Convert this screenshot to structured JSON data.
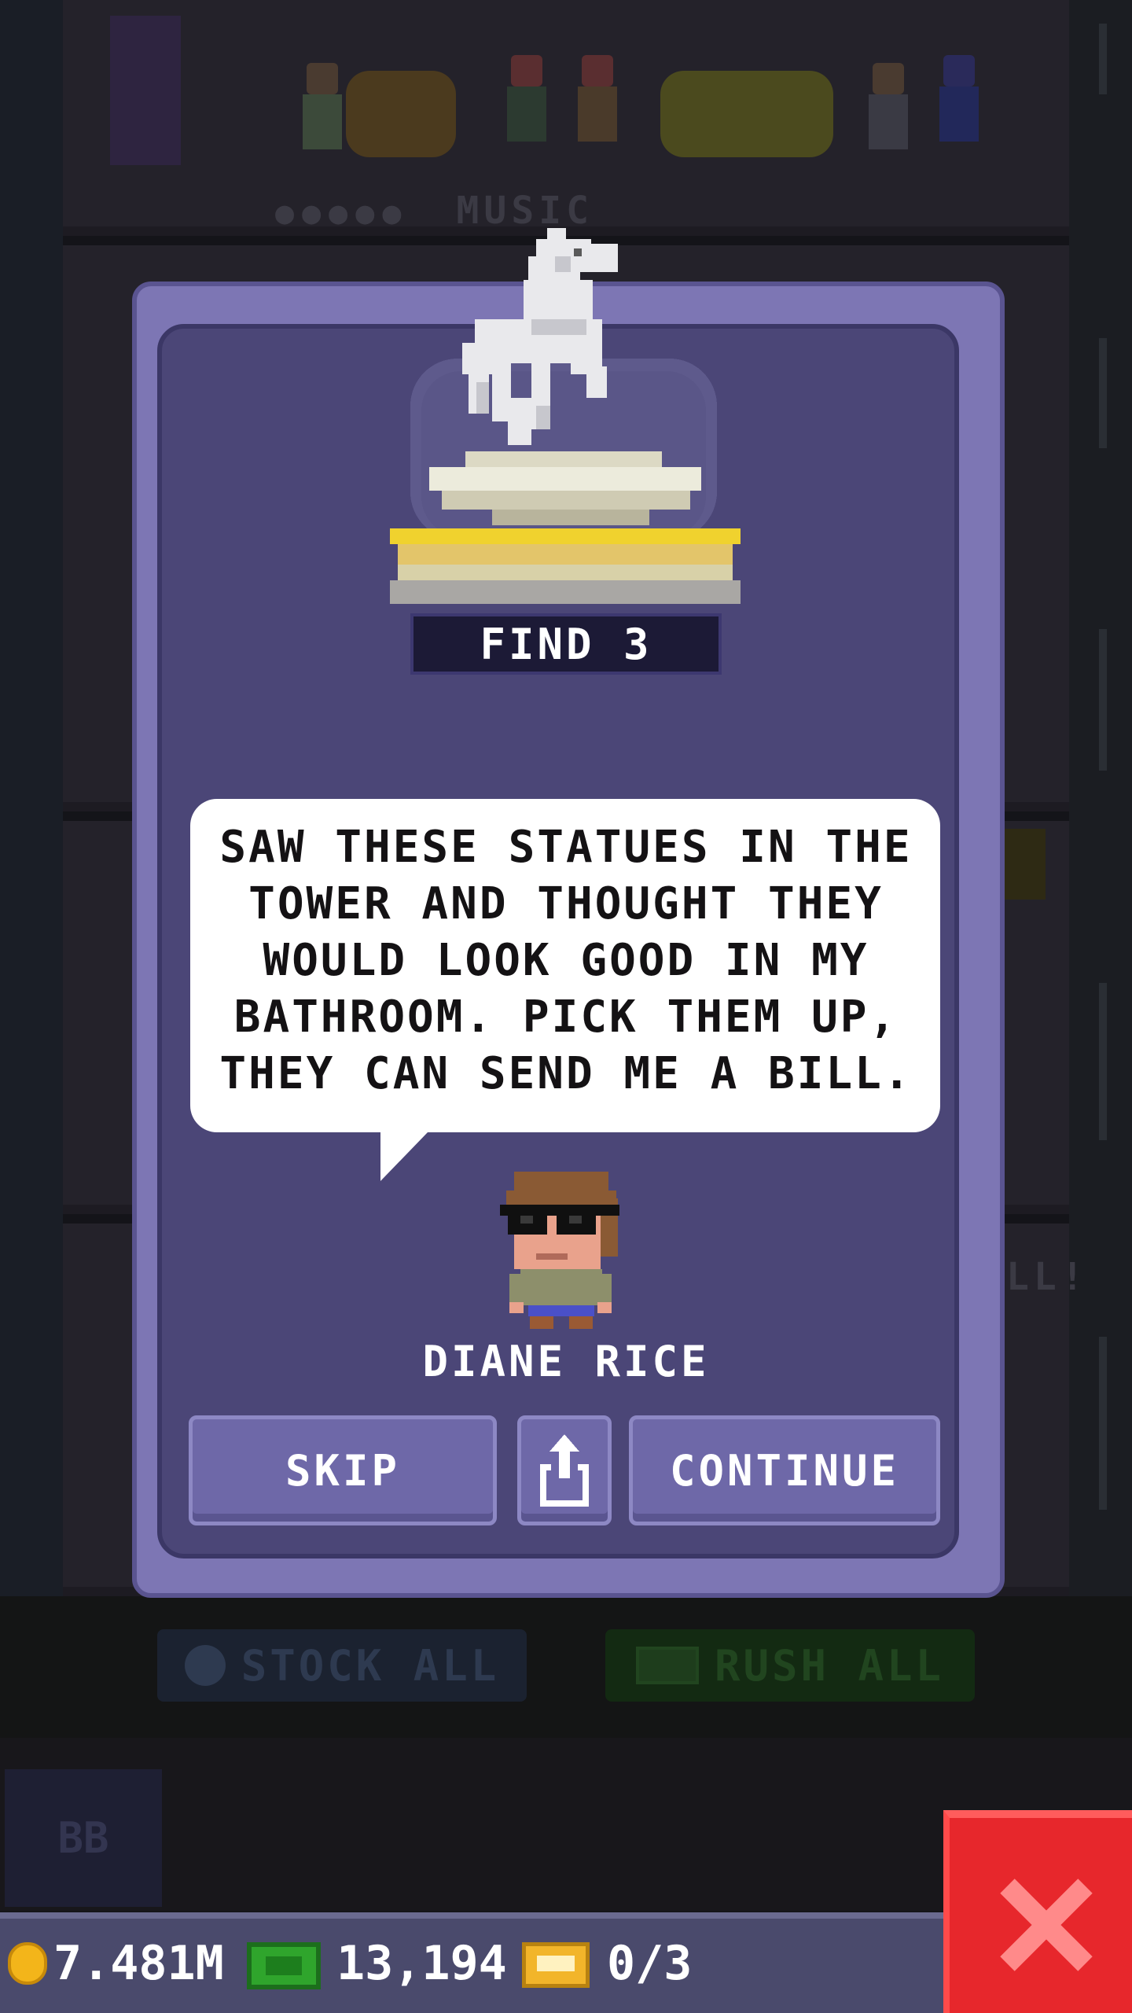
{
  "background": {
    "floor_number": "5",
    "floor_label": "MUSIC",
    "stock_all_label": "STOCK ALL",
    "rush_all_label": "RUSH ALL",
    "lobby_sign": "BB"
  },
  "dialog": {
    "trophy_icon": "horse-statue-trophy-icon",
    "find_label": "FIND 3",
    "message": "SAW THESE STATUES IN THE\nTOWER AND THOUGHT THEY\nWOULD LOOK GOOD IN MY\nBATHROOM. PICK THEM UP,\nTHEY CAN SEND ME A BILL.",
    "character_name": "DIANE RICE",
    "skip_label": "SKIP",
    "share_icon": "share-icon",
    "continue_label": "CONTINUE"
  },
  "status_bar": {
    "coins": "7.481M",
    "bux": "13,194",
    "tickets": "0/3"
  },
  "close_icon": "close-x-icon",
  "colors": {
    "dialog_outer": "#7d76b4",
    "dialog_inner": "#4b4677",
    "button": "#6e68a8",
    "close_red": "#e7272c",
    "coin_gold": "#f3b51a",
    "bux_green": "#2fa52c"
  }
}
